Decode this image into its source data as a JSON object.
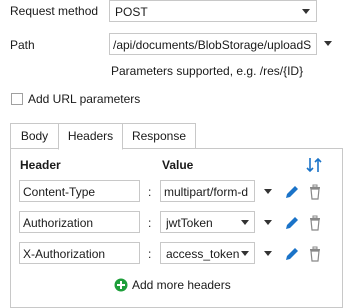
{
  "request_method": {
    "label": "Request method",
    "value": "POST"
  },
  "path": {
    "label": "Path",
    "value": "/api/documents/BlobStorage/uploadS",
    "hint": "Parameters supported, e.g. /res/{ID}"
  },
  "add_url_params": {
    "label": "Add URL parameters",
    "checked": false
  },
  "tabs": [
    {
      "label": "Body",
      "active": false
    },
    {
      "label": "Headers",
      "active": true
    },
    {
      "label": "Response",
      "active": false
    }
  ],
  "headers_table": {
    "col_header": "Header",
    "col_value": "Value",
    "rows": [
      {
        "name": "Content-Type",
        "value": "multipart/form-d"
      },
      {
        "name": "Authorization",
        "value": "jwtToken"
      },
      {
        "name": "X-Authorization",
        "value": "access_token"
      }
    ],
    "separator": ":"
  },
  "add_more": {
    "label": "Add more headers"
  },
  "colors": {
    "accent_blue": "#1a73c8",
    "add_green": "#1e9e3a",
    "border": "#c8c8c8"
  },
  "icons": [
    "chevron-down-icon",
    "pencil-icon",
    "trash-icon",
    "sort-icon",
    "plus-circle-icon"
  ]
}
